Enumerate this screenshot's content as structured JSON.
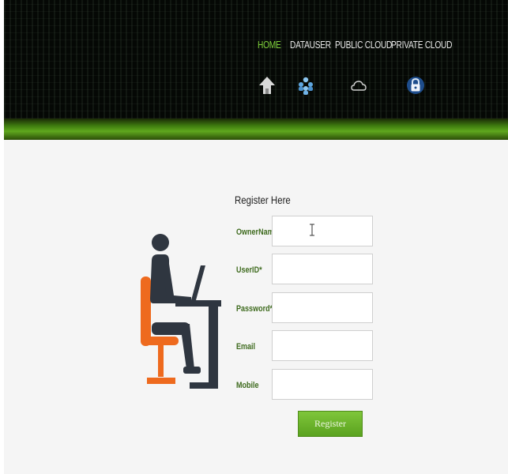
{
  "nav": {
    "items": [
      {
        "label": "HOME",
        "active": true,
        "icon": "home-icon"
      },
      {
        "label": "DATAUSER",
        "active": false,
        "icon": "users-icon"
      },
      {
        "label": "PUBLIC CLOUD",
        "active": false,
        "icon": "cloud-icon"
      },
      {
        "label": "PRIVATE CLOUD",
        "active": false,
        "icon": "lock-icon"
      }
    ]
  },
  "form": {
    "title": "Register Here",
    "fields": [
      {
        "label": "OwnerName",
        "value": ""
      },
      {
        "label": "UserID*",
        "value": ""
      },
      {
        "label": "Password*",
        "value": ""
      },
      {
        "label": "Email",
        "value": ""
      },
      {
        "label": "Mobile",
        "value": ""
      }
    ],
    "submit_label": "Register"
  },
  "colors": {
    "accent_green": "#5aa21f",
    "nav_active": "#7fd13a",
    "label_green": "#3f6b1f",
    "illustration_orange": "#ee6a1e",
    "illustration_dark": "#2f3640"
  }
}
